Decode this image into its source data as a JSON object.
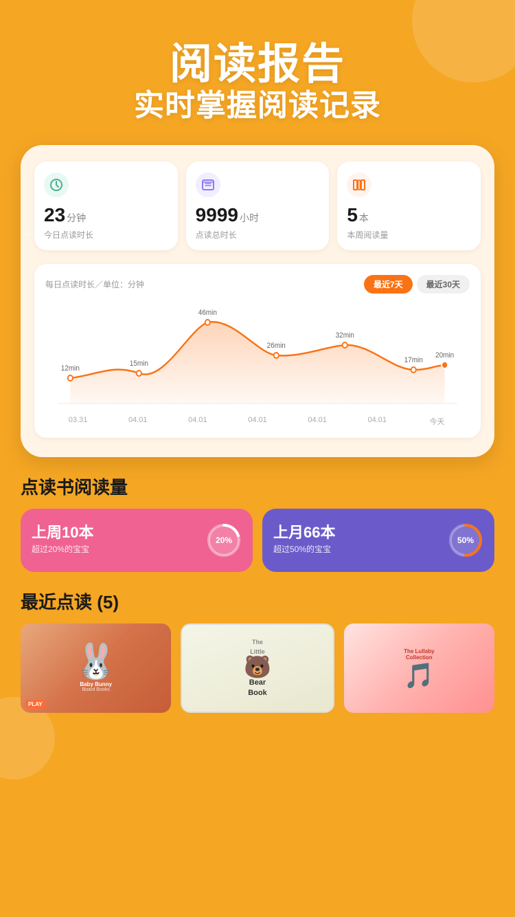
{
  "header": {
    "title": "阅读报告",
    "subtitle": "实时掌握阅读记录"
  },
  "stats": [
    {
      "icon": "clock",
      "icon_bg": "clock",
      "value": "23",
      "unit": "分钟",
      "label": "今日点读时长"
    },
    {
      "icon": "calendar",
      "icon_bg": "book",
      "value": "9999",
      "unit": "小时",
      "label": "点读总时长"
    },
    {
      "icon": "shelf",
      "icon_bg": "shelf",
      "value": "5",
      "unit": "本",
      "label": "本周阅读量"
    }
  ],
  "chart": {
    "label": "每日点读时长／单位：分钟",
    "tabs": [
      "最近7天",
      "最近30天"
    ],
    "active_tab": 0,
    "data_points": [
      {
        "label": "03.31",
        "value": 12,
        "display": "12min"
      },
      {
        "label": "04.01",
        "value": 15,
        "display": "15min"
      },
      {
        "label": "04.01",
        "value": 46,
        "display": "46min"
      },
      {
        "label": "04.01",
        "value": 26,
        "display": "26min"
      },
      {
        "label": "04.01",
        "value": 32,
        "display": "32min"
      },
      {
        "label": "04.01",
        "value": 17,
        "display": "17min"
      },
      {
        "label": "今天",
        "value": 20,
        "display": "20min"
      }
    ]
  },
  "reading_volume": {
    "title": "点读书阅读量",
    "cards": [
      {
        "count": "上周10本",
        "desc": "超过20%的宝宝",
        "percent": 20,
        "percent_label": "20%",
        "color": "pink"
      },
      {
        "count": "上月66本",
        "desc": "超过50%的宝宝",
        "percent": 50,
        "percent_label": "50%",
        "color": "purple"
      }
    ]
  },
  "recent_reading": {
    "title": "最近点读 (5)",
    "books": [
      {
        "id": "book-1",
        "name": "Baby Bunny Board Books",
        "badge": "PLAY"
      },
      {
        "id": "book-2",
        "name": "The Bear Book",
        "title_line1": "The",
        "title_line2": "Little",
        "title_line3": "Bear",
        "title_line4": "Book"
      },
      {
        "id": "book-3",
        "name": "The Lullaby Collection"
      }
    ]
  }
}
